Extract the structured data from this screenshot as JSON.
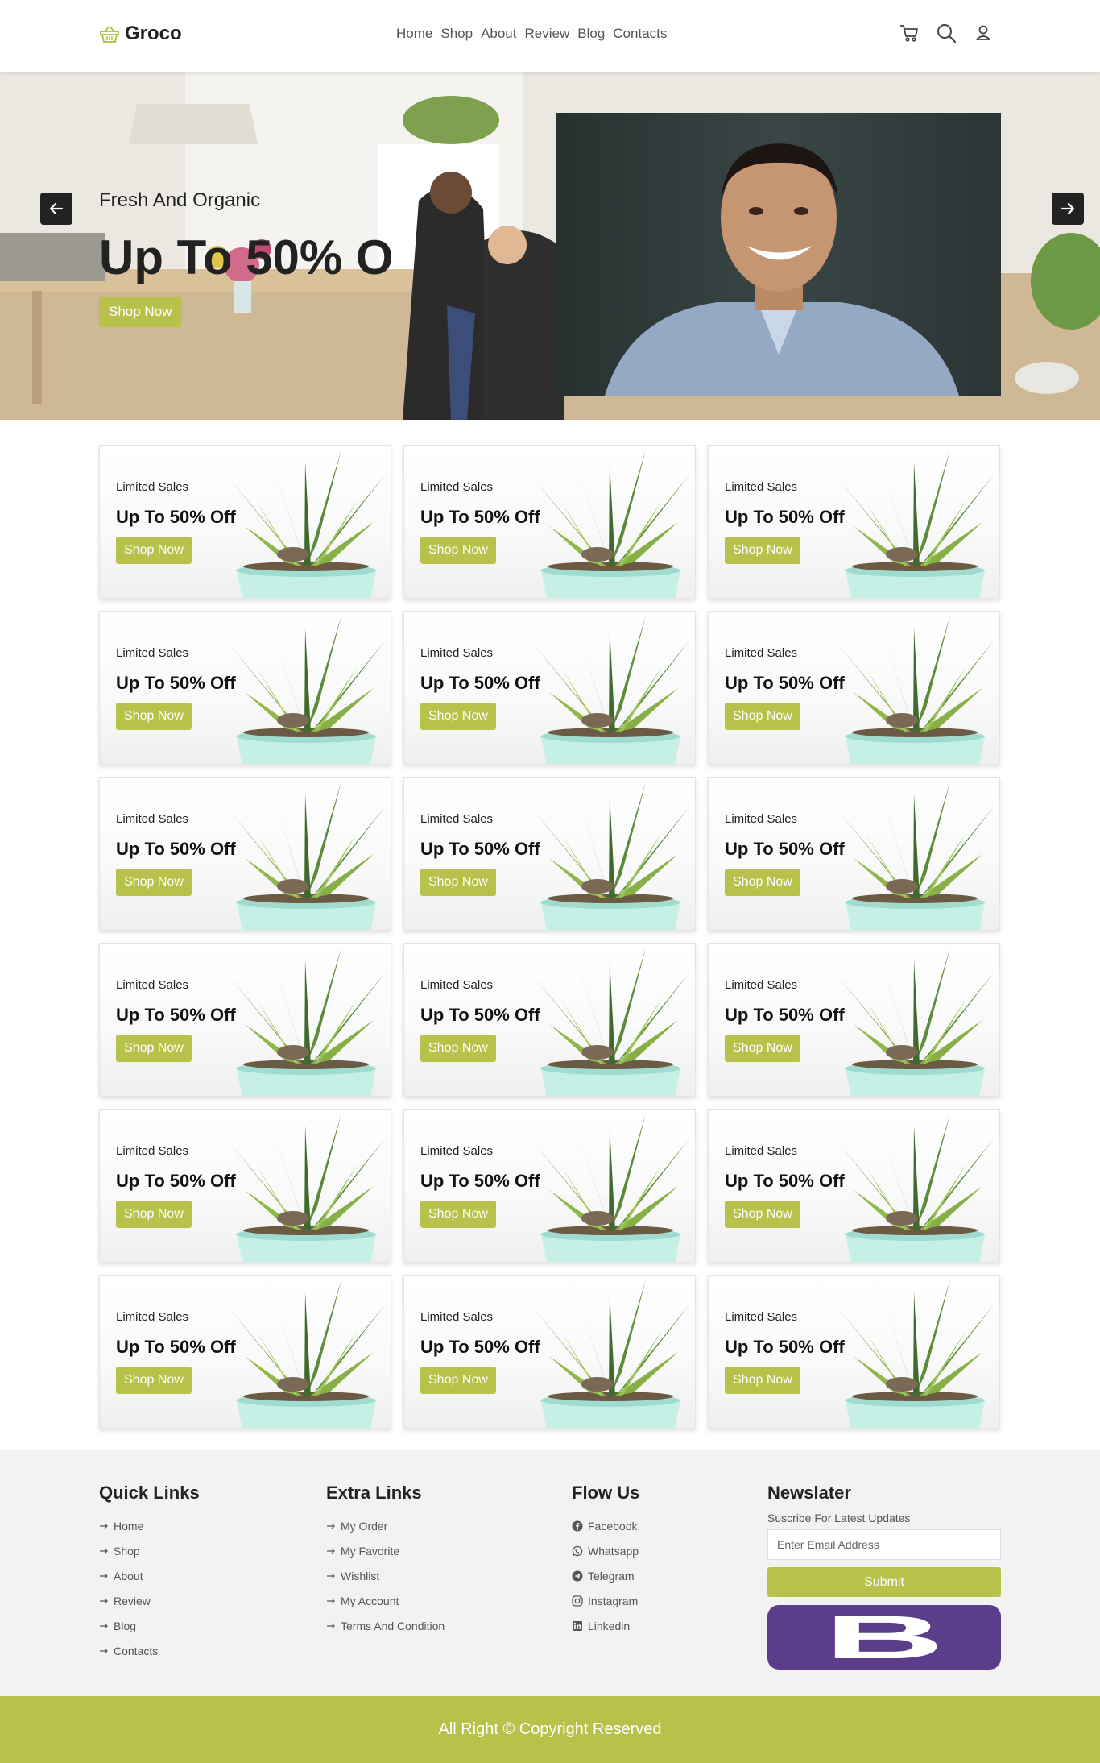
{
  "brand": {
    "name": "Groco",
    "icon": "basket-icon"
  },
  "nav": {
    "links": [
      "Home",
      "Shop",
      "About",
      "Review",
      "Blog",
      "Contacts"
    ],
    "icons": [
      "cart-icon",
      "search-icon",
      "user-icon"
    ]
  },
  "hero": {
    "subtitle": "Fresh And Organic",
    "title": "Up To 50% Off",
    "button": "Shop Now"
  },
  "promo_cards": {
    "small": "Limited Sales",
    "big": "Up To 50% Off",
    "button": "Shop Now",
    "count": 18
  },
  "footer": {
    "quick_links": {
      "title": "Quick Links",
      "items": [
        "Home",
        "Shop",
        "About",
        "Review",
        "Blog",
        "Contacts"
      ]
    },
    "extra_links": {
      "title": "Extra Links",
      "items": [
        "My Order",
        "My Favorite",
        "Wishlist",
        "My Account",
        "Terms And Condition"
      ]
    },
    "follow": {
      "title": "Flow Us",
      "items": [
        {
          "label": "Facebook",
          "icon": "facebook-icon"
        },
        {
          "label": "Whatsapp",
          "icon": "whatsapp-icon"
        },
        {
          "label": "Telegram",
          "icon": "telegram-icon"
        },
        {
          "label": "Instagram",
          "icon": "instagram-icon"
        },
        {
          "label": "Linkedin",
          "icon": "linkedin-icon"
        }
      ]
    },
    "newsletter": {
      "title": "Newslater",
      "subtitle": "Suscribe For Latest Updates",
      "placeholder": "Enter Email Address",
      "button": "Submit",
      "logo_letter": "B"
    },
    "copyright": "All Right © Copyright Reserved"
  },
  "colors": {
    "accent": "#b8c14a",
    "dark": "#222222",
    "footer_bg": "#f2f2f2",
    "logo_purple": "#5b3d8a"
  }
}
